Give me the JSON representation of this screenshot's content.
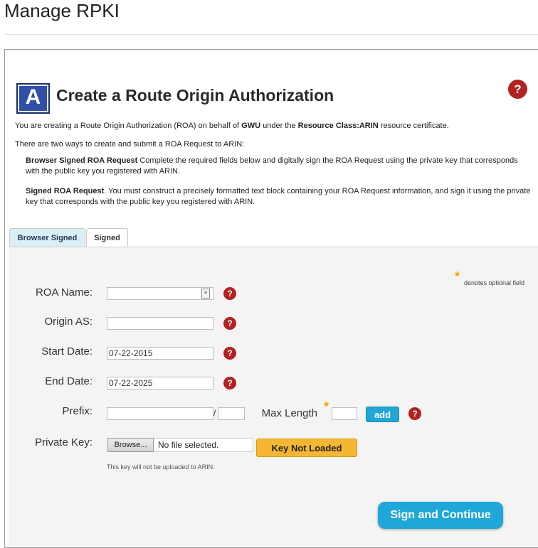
{
  "page": {
    "title": "Manage RPKI"
  },
  "section": {
    "badge_letter": "A",
    "title": "Create a Route Origin Authorization",
    "help_glyph": "?"
  },
  "intro": {
    "line1_a": "You are creating a Route Origin Authorization (ROA) on behalf of ",
    "line1_org": "GWU",
    "line1_b": " under the ",
    "line1_resource": "Resource Class:ARIN",
    "line1_c": " resource certificate.",
    "line2": "There are two ways to create and submit a ROA Request to ARIN:",
    "opt1_title": "Browser Signed ROA Request",
    "opt1_text": " Complete the required fields below and digitally sign the ROA Request using the private key that corresponds with the public key you registered with ARIN.",
    "opt2_title": "Signed ROA Request",
    "opt2_text": ". You must construct a precisely formatted text block containing your ROA Request information, and sign it using the private key that corresponds with the public key you registered with ARIN."
  },
  "tabs": [
    {
      "label": "Browser Signed",
      "active": true
    },
    {
      "label": "Signed",
      "active": false
    }
  ],
  "form": {
    "optional_note": "denotes optional field",
    "roa_name": {
      "label": "ROA Name:",
      "value": ""
    },
    "origin_as": {
      "label": "Origin AS:",
      "value": ""
    },
    "start_date": {
      "label": "Start Date:",
      "value": "07-22-2015"
    },
    "end_date": {
      "label": "End Date:",
      "value": "07-22-2025"
    },
    "prefix": {
      "label": "Prefix:",
      "address": "",
      "length": "",
      "separator": "/"
    },
    "max_length": {
      "label": "Max Length",
      "value": ""
    },
    "add_button": "add",
    "private_key": {
      "label": "Private Key:",
      "browse_button": "Browse...",
      "file_status": "No file selected.",
      "key_status_button": "Key Not Loaded",
      "note": "This key will not be uploaded to ARIN."
    },
    "submit_button": "Sign and Continue"
  },
  "colors": {
    "help": "#b22222",
    "accent_blue": "#1fa7d9",
    "key_button": "#f5b731",
    "optional_star": "#f0a30a"
  }
}
